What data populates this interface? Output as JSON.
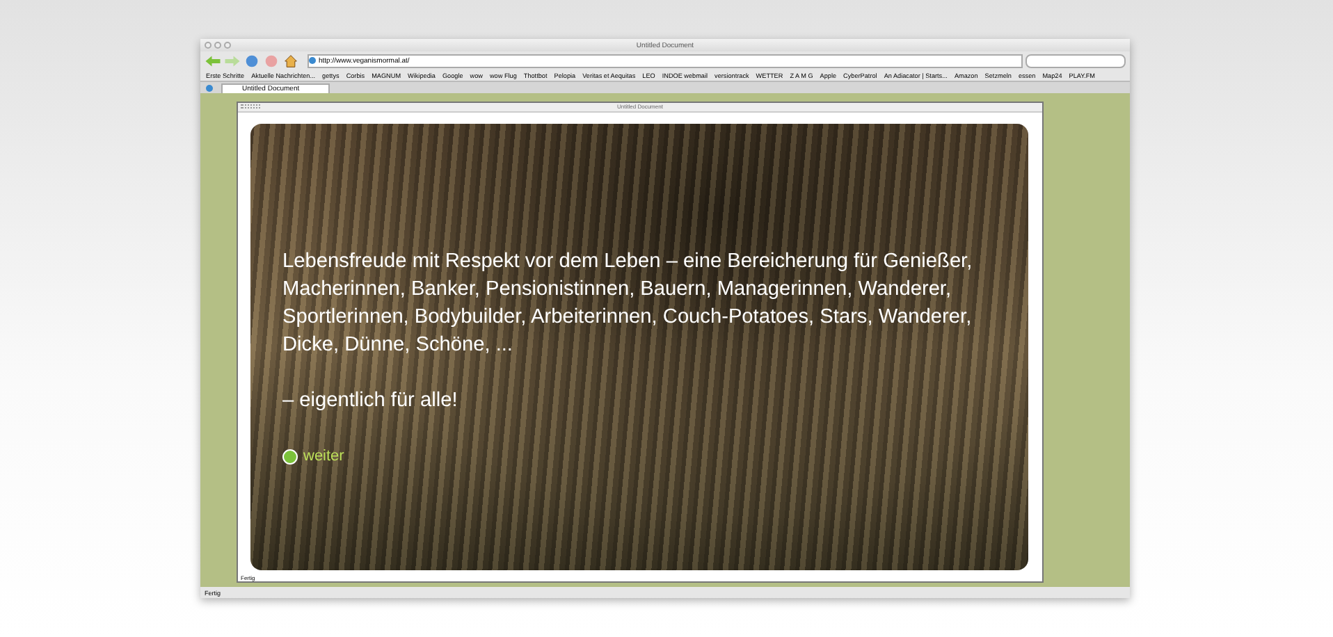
{
  "window": {
    "title": "Untitled Document"
  },
  "toolbar": {
    "address": "http://www.veganismormal.at/"
  },
  "bookmarks": [
    "Erste Schritte",
    "Aktuelle Nachrichten...",
    "gettys",
    "Corbis",
    "MAGNUM",
    "Wikipedia",
    "Google",
    "wow",
    "wow Flug",
    "Thottbot",
    "Pelopia",
    "Veritas et Aequitas",
    "LEO",
    "INDOE webmail",
    "versiontrack",
    "WETTER",
    "Z A M G",
    "Apple",
    "CyberPatrol",
    "An Adiacator | Starts...",
    "Amazon",
    "Setzmeln",
    "essen",
    "Map24",
    "PLAY.FM"
  ],
  "tabs": [
    {
      "label": "Untitled Document",
      "selected": true
    }
  ],
  "inner_window": {
    "title": "Untitled Document",
    "status": "Fertig"
  },
  "content": {
    "paragraphs": [
      "Lebensfreude mit Respekt vor dem Leben – eine Bereicherung für Genießer, Macherinnen, Banker, Pensionistinnen, Bauern, Managerinnen, Wanderer, Sportlerinnen, Bodybuilder, Arbeiterinnen, Couch-Potatoes, Stars, Wanderer, Dicke, Dünne, Schöne, ...",
      "– eigentlich für alle!"
    ],
    "link": "weiter"
  },
  "status_bar": "Fertig"
}
